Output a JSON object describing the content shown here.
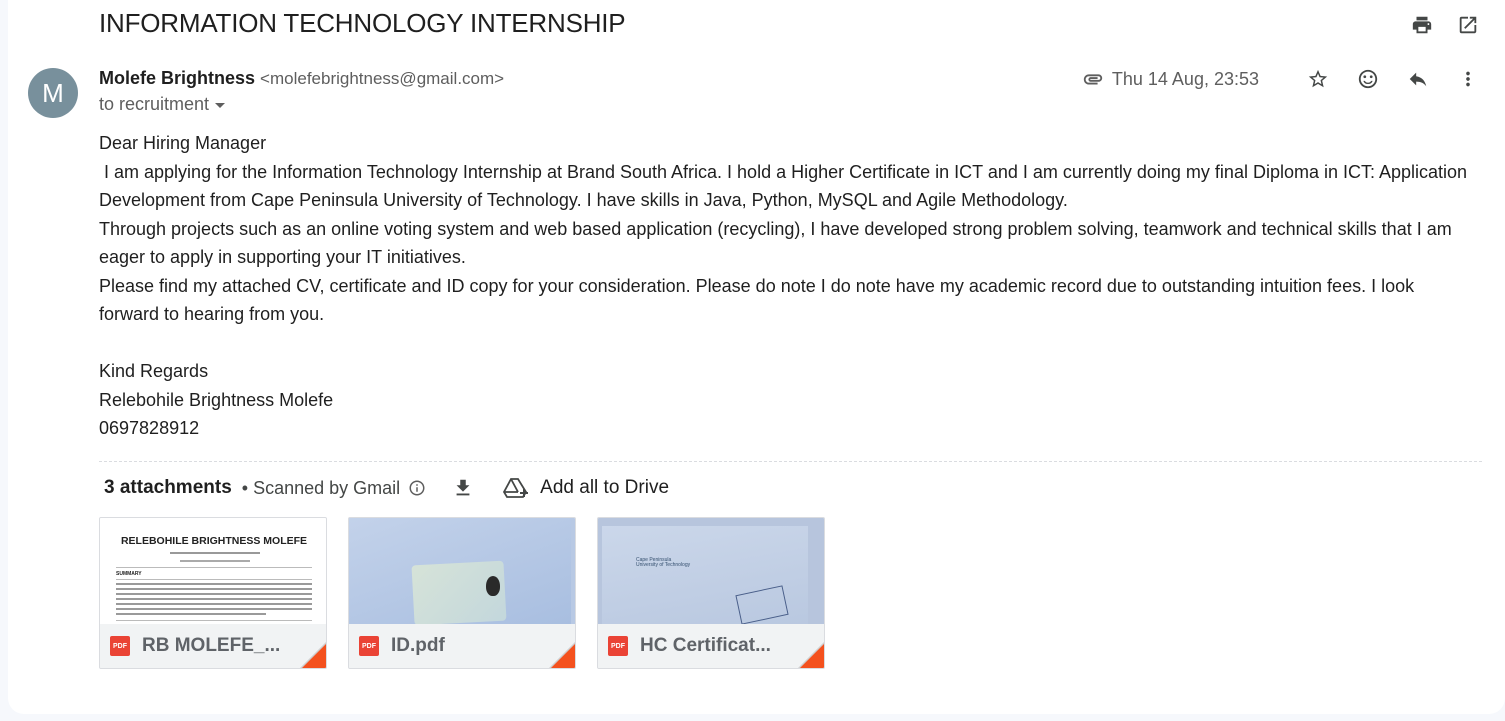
{
  "subject": "INFORMATION TECHNOLOGY INTERNSHIP",
  "header_icons": [
    "print-icon",
    "open-new-window-icon"
  ],
  "sender": {
    "avatar_letter": "M",
    "avatar_color": "#78909c",
    "name": "Molefe Brightness",
    "email": "<molefebrightness@gmail.com>",
    "to": "to recruitment"
  },
  "meta": {
    "timestamp": "Thu 14 Aug, 23:53",
    "icons": [
      "attachment-clip-icon",
      "star-icon",
      "emoji-reaction-icon",
      "reply-icon",
      "more-vert-icon"
    ]
  },
  "body": {
    "greeting": "Dear Hiring Manager",
    "p1": " I am applying for the Information Technology Internship at Brand South Africa. I hold a Higher Certificate in ICT and I am currently doing my final Diploma in ICT: Application Development from Cape Peninsula University of Technology. I have skills in Java, Python, MySQL and Agile Methodology.",
    "p2": "Through projects such as an online voting system and web based application (recycling), I have developed strong problem solving, teamwork and technical skills that I am eager to apply in supporting your IT initiatives.",
    "p3": "Please find my attached CV, certificate and ID copy for your consideration. Please do note I do note have my academic record due to outstanding intuition fees. I look forward to hearing from you.",
    "signoff": "Kind Regards",
    "sig_name": "Relebohile Brightness Molefe",
    "sig_phone": "0697828912"
  },
  "attachments_bar": {
    "count": "3 attachments",
    "scanned": "• Scanned by Gmail",
    "add_drive": "Add all to Drive"
  },
  "attachments": [
    {
      "name": "RB MOLEFE_...",
      "type": "PDF",
      "preview_title": "RELEBOHILE BRIGHTNESS MOLEFE",
      "preview_heading": "SUMMARY"
    },
    {
      "name": "ID.pdf",
      "type": "PDF"
    },
    {
      "name": "HC Certificat...",
      "type": "PDF",
      "preview_logo_1": "Cape Peninsula",
      "preview_logo_2": "University of Technology"
    }
  ],
  "colors": {
    "pdf_red": "#ea4335",
    "fold_orange": "#f4511e"
  }
}
